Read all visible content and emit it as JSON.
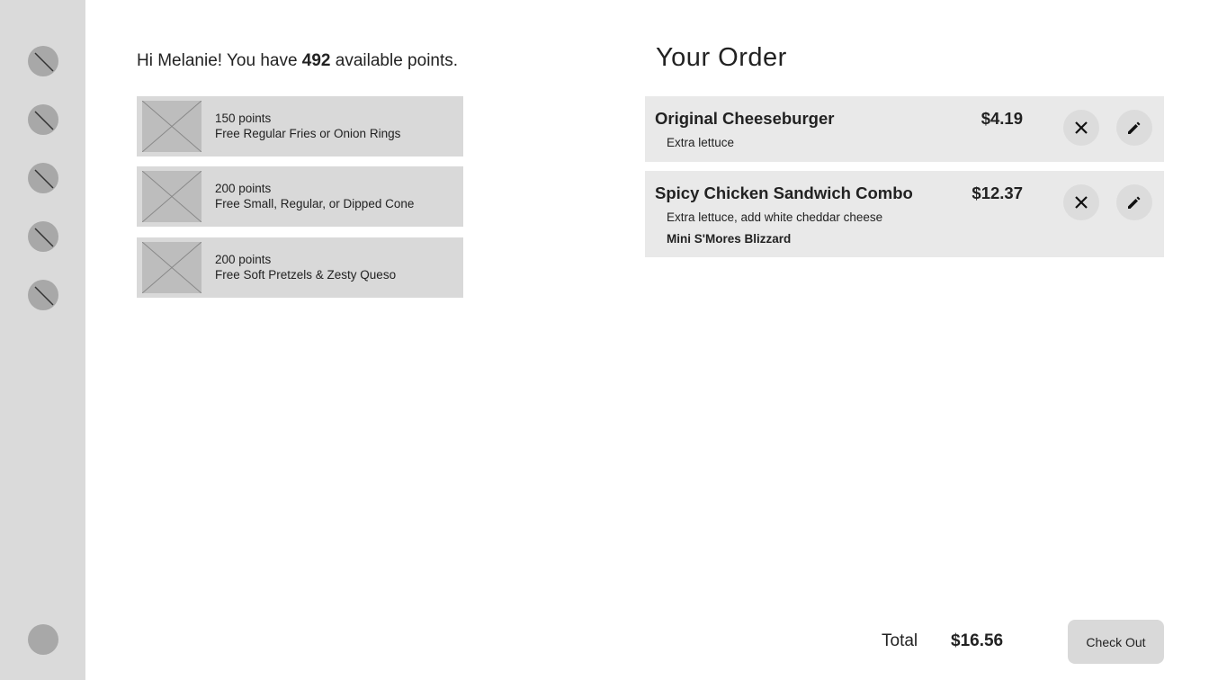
{
  "sidebar": {
    "items": [
      {
        "icon": "placeholder-icon"
      },
      {
        "icon": "placeholder-icon"
      },
      {
        "icon": "placeholder-icon"
      },
      {
        "icon": "placeholder-icon"
      },
      {
        "icon": "placeholder-icon"
      }
    ],
    "profile_icon": "avatar-icon"
  },
  "greeting": {
    "prefix": "Hi Melanie! You have ",
    "points": "492",
    "suffix": " available points."
  },
  "rewards": [
    {
      "points": "150 points",
      "description": "Free Regular Fries or Onion Rings",
      "image_icon": "image-placeholder-icon"
    },
    {
      "points": "200 points",
      "description": "Free Small, Regular, or Dipped Cone",
      "image_icon": "image-placeholder-icon"
    },
    {
      "points": "200 points",
      "description": "Free Soft Pretzels & Zesty Queso",
      "image_icon": "image-placeholder-icon"
    }
  ],
  "order": {
    "title": "Your Order",
    "items": [
      {
        "name": "Original Cheeseburger",
        "price": "$4.19",
        "modifiers": [
          "Extra lettuce"
        ]
      },
      {
        "name": "Spicy Chicken Sandwich Combo",
        "price": "$12.37",
        "modifiers": [
          "Extra lettuce, add white cheddar cheese"
        ],
        "addon": "Mini S'Mores Blizzard"
      }
    ],
    "remove_icon": "close-icon",
    "edit_icon": "pencil-icon"
  },
  "footer": {
    "total_label": "Total",
    "total_value": "$16.56",
    "checkout_label": "Check Out"
  },
  "colors": {
    "sidebar_bg": "#dadada",
    "card_bg": "#d9d9d9",
    "order_row_bg": "#e9e9e9",
    "text": "#222222"
  }
}
